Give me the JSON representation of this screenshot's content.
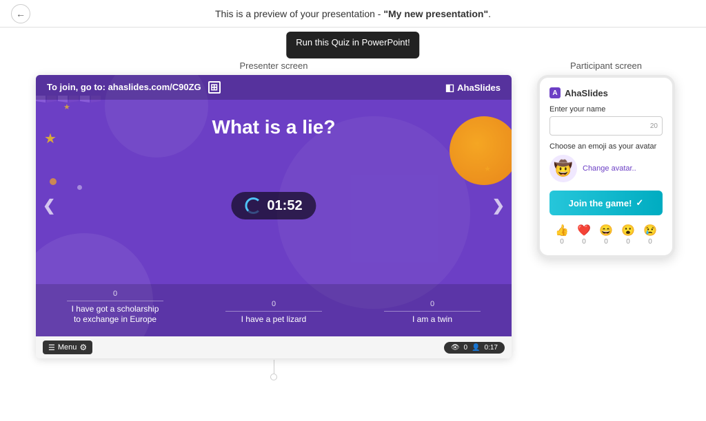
{
  "topbar": {
    "preview_text": "This is a preview of your presentation - ",
    "presentation_name": "\"My new presentation\"",
    "period": "."
  },
  "tooltip": {
    "label": "Run this Quiz in PowerPoint!"
  },
  "presenter": {
    "label": "Presenter screen",
    "join_text": "To join, go to: ",
    "join_url": "ahaslides.com/C90ZG",
    "brand_name": "AhaSlides",
    "question": "What is a lie?",
    "timer": "01:52",
    "answers": [
      {
        "count": "0",
        "text": "I have got a scholarship\nto exchange in Europe"
      },
      {
        "count": "0",
        "text": "I have a pet lizard"
      },
      {
        "count": "0",
        "text": "I am a twin"
      }
    ],
    "menu_label": "Menu",
    "viewers_count": "0",
    "players_count": "0:17"
  },
  "participant": {
    "label": "Participant screen",
    "brand_name": "AhaSlides",
    "name_label": "Enter your name",
    "name_char_count": "20",
    "avatar_label": "Choose an emoji as your avatar",
    "avatar_emoji": "🤠",
    "change_avatar_label": "Change avatar..",
    "join_button_label": "Join the game!",
    "reactions": [
      {
        "emoji": "👍",
        "count": "0"
      },
      {
        "emoji": "❤️",
        "count": "0"
      },
      {
        "emoji": "😄",
        "count": "0"
      },
      {
        "emoji": "😮",
        "count": "0"
      },
      {
        "emoji": "😢",
        "count": "0"
      }
    ]
  }
}
